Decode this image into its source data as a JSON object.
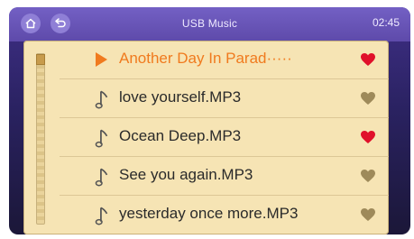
{
  "header": {
    "title": "USB Music",
    "time": "02:45"
  },
  "playlist": {
    "items": [
      {
        "title": "Another Day In Parad·····",
        "playing": true,
        "favorite": true
      },
      {
        "title": "love yourself.MP3",
        "playing": false,
        "favorite": false
      },
      {
        "title": "Ocean Deep.MP3",
        "playing": false,
        "favorite": true
      },
      {
        "title": "See you again.MP3",
        "playing": false,
        "favorite": false
      },
      {
        "title": "yesterday once more.MP3",
        "playing": false,
        "favorite": false
      }
    ]
  },
  "colors": {
    "heart_on": "#e0102a",
    "heart_off": "#9e8a5a",
    "active_text": "#f07a1e"
  },
  "icons": {
    "home": "home-icon",
    "back": "back-icon",
    "playing": "play-icon",
    "track": "music-note-icon",
    "favorite": "heart-icon"
  }
}
